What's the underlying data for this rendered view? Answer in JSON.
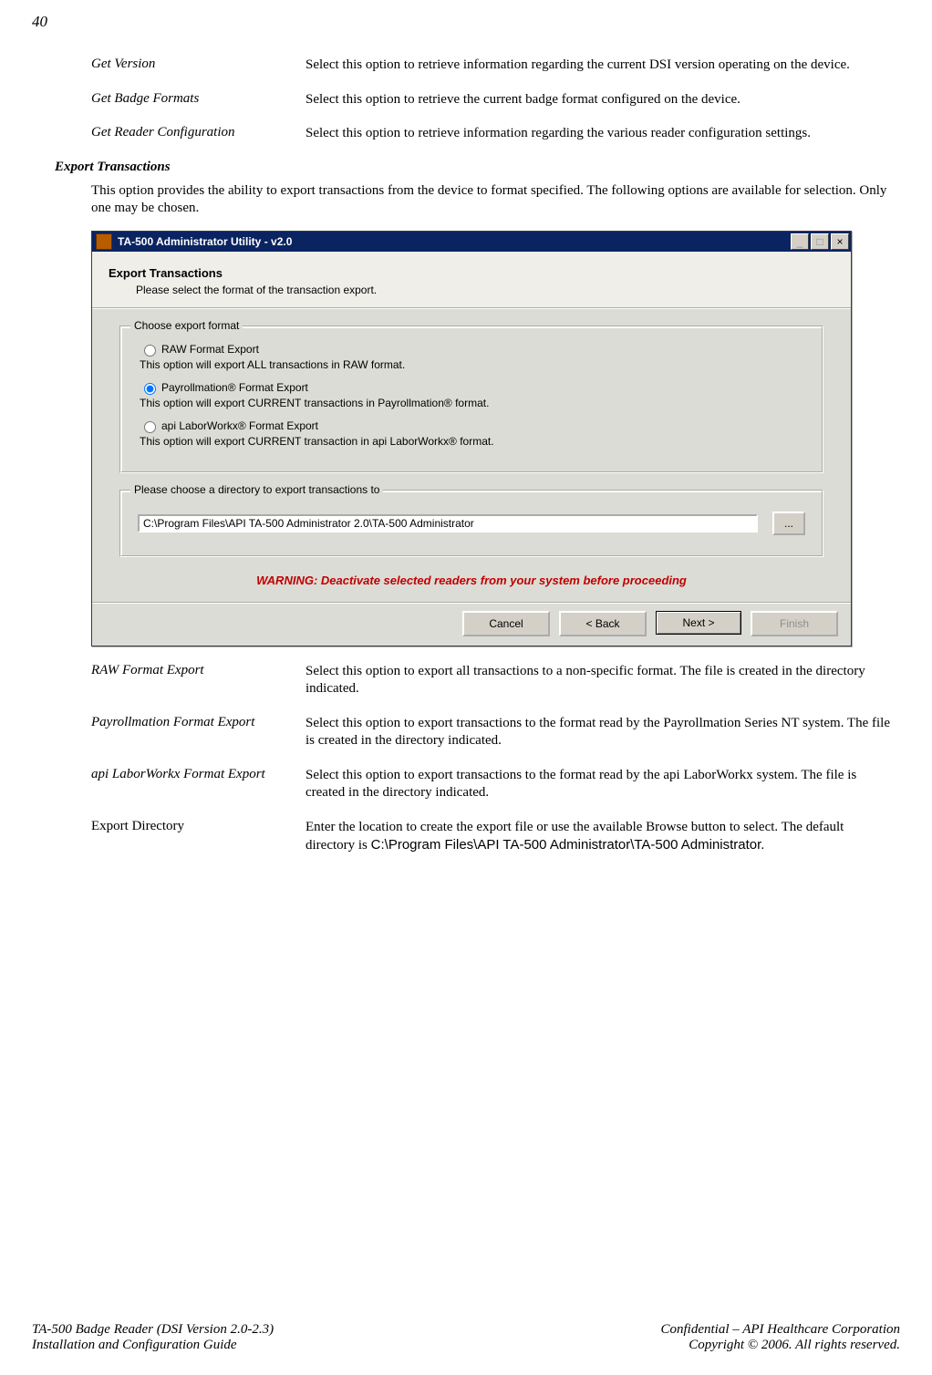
{
  "page_number": "40",
  "defs_top": [
    {
      "term": "Get Version",
      "desc": "Select this option to retrieve information regarding the current DSI version operating on the device."
    },
    {
      "term": "Get Badge Formats",
      "desc": "Select this option to retrieve the current badge format configured on the device."
    },
    {
      "term": "Get Reader Configuration",
      "desc": "Select this option to retrieve information regarding the various reader configuration settings."
    }
  ],
  "section_heading": "Export Transactions",
  "section_intro": "This option provides the ability to export transactions from the device to format specified.  The following options are available for selection.  Only one may be chosen.",
  "window": {
    "title": "TA-500 Administrator Utility - v2.0",
    "heading": "Export Transactions",
    "subheading": "Please select the format of the transaction export.",
    "group_format_legend": "Choose export format",
    "options": [
      {
        "label": "RAW Format Export",
        "desc": "This option will export ALL transactions in RAW format.",
        "selected": false
      },
      {
        "label": "Payrollmation® Format Export",
        "desc": "This option will export CURRENT transactions in Payrollmation® format.",
        "selected": true
      },
      {
        "label": "api LaborWorkx® Format Export",
        "desc": "This option will export CURRENT transaction in api LaborWorkx® format.",
        "selected": false
      }
    ],
    "group_dir_legend": "Please choose a directory to export transactions to",
    "directory_value": "C:\\Program Files\\API TA-500 Administrator 2.0\\TA-500 Administrator",
    "browse_label": "...",
    "warning": "WARNING: Deactivate selected readers from your system before proceeding",
    "buttons": {
      "cancel": "Cancel",
      "back": "< Back",
      "next": "Next >",
      "finish": "Finish"
    }
  },
  "defs_bottom": [
    {
      "term": "RAW Format Export",
      "italic": true,
      "desc": "Select this option to export all transactions to a non-specific format.  The file is created in the directory indicated."
    },
    {
      "term": "Payrollmation Format Export",
      "italic": true,
      "desc": "Select this option to export transactions to the format read by the Payrollmation Series NT system.  The file is created in the directory indicated."
    },
    {
      "term": "api LaborWorkx Format Export",
      "italic": true,
      "desc": "Select this option to export transactions to the format read by the api LaborWorkx system.  The file is created in the directory indicated."
    },
    {
      "term": "Export Directory",
      "italic": false,
      "desc_prefix": "Enter the location to create the export file or use the available Browse button to select.  The default directory is ",
      "desc_code": "C:\\Program Files\\API TA-500 Administrator\\TA-500 Administrator.",
      "desc_suffix": ""
    }
  ],
  "footer": {
    "left1": "TA-500 Badge Reader (DSI Version 2.0-2.3)",
    "left2": "Installation and Configuration Guide",
    "right1": "Confidential – API Healthcare Corporation",
    "right2": "Copyright © 2006.  All rights reserved."
  }
}
